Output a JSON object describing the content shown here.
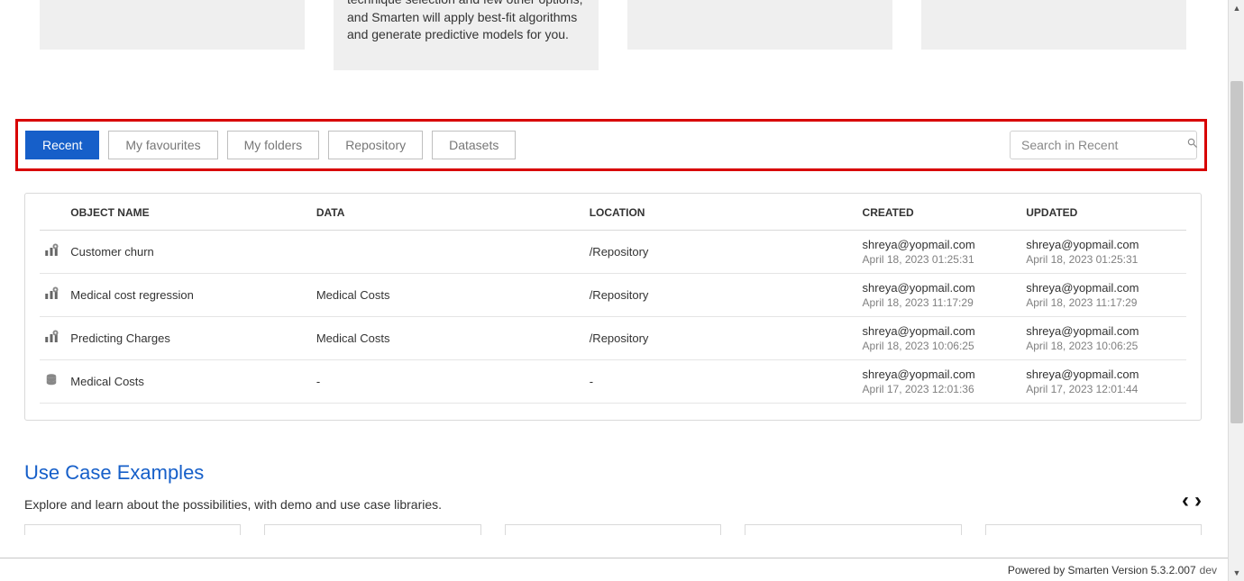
{
  "top_cards": {
    "card2_text": "technique selection and few other options, and Smarten will apply best-fit algorithms and generate predictive models for you."
  },
  "tabs": {
    "items": [
      "Recent",
      "My favourites",
      "My folders",
      "Repository",
      "Datasets"
    ],
    "active_index": 0
  },
  "search": {
    "placeholder": "Search in Recent"
  },
  "table": {
    "headers": [
      "OBJECT NAME",
      "DATA",
      "LOCATION",
      "CREATED",
      "UPDATED"
    ],
    "rows": [
      {
        "icon": "model",
        "name": "Customer churn",
        "data": "",
        "location": "/Repository",
        "created_by": "shreya@yopmail.com",
        "created_at": "April 18, 2023 01:25:31",
        "updated_by": "shreya@yopmail.com",
        "updated_at": "April 18, 2023 01:25:31"
      },
      {
        "icon": "model",
        "name": "Medical cost regression",
        "data": "Medical Costs",
        "location": "/Repository",
        "created_by": "shreya@yopmail.com",
        "created_at": "April 18, 2023 11:17:29",
        "updated_by": "shreya@yopmail.com",
        "updated_at": "April 18, 2023 11:17:29"
      },
      {
        "icon": "model",
        "name": "Predicting Charges",
        "data": "Medical Costs",
        "location": "/Repository",
        "created_by": "shreya@yopmail.com",
        "created_at": "April 18, 2023 10:06:25",
        "updated_by": "shreya@yopmail.com",
        "updated_at": "April 18, 2023 10:06:25"
      },
      {
        "icon": "dataset",
        "name": "Medical Costs",
        "data": "-",
        "location": "-",
        "created_by": "shreya@yopmail.com",
        "created_at": "April 17, 2023 12:01:36",
        "updated_by": "shreya@yopmail.com",
        "updated_at": "April 17, 2023 12:01:44"
      }
    ]
  },
  "usecase": {
    "title": "Use Case Examples",
    "subtitle": "Explore and learn about the possibilities, with demo and use case libraries."
  },
  "footer": {
    "text": "Powered by Smarten Version 5.3.2.007",
    "suffix": "dev"
  }
}
